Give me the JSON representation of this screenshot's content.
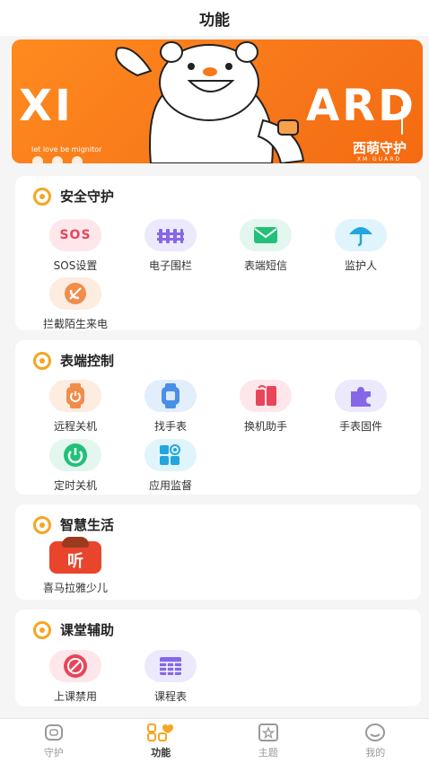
{
  "header": {
    "title": "功能"
  },
  "banner": {
    "big_left": "XI",
    "big_right": "ARD",
    "tagline": "let love be mignitor",
    "brand": "西萌守护",
    "brand_sub": "XM·GUARD"
  },
  "sections": [
    {
      "title": "安全守护",
      "items": [
        {
          "label": "SOS设置",
          "icon": "sos-icon",
          "glyph": "SOS",
          "bg": "#fde7ea",
          "color": "#e8455a"
        },
        {
          "label": "电子围栏",
          "icon": "fence-icon",
          "bg": "#ede9fc",
          "color": "#8667e8"
        },
        {
          "label": "表端短信",
          "icon": "message-icon",
          "bg": "#e3f7ee",
          "color": "#22c07a"
        },
        {
          "label": "监护人",
          "icon": "umbrella-icon",
          "bg": "#e0f4fb",
          "color": "#22a6dd"
        },
        {
          "label": "拦截陌生来电",
          "icon": "block-call-icon",
          "bg": "#fdece0",
          "color": "#f08d4a"
        }
      ]
    },
    {
      "title": "表端控制",
      "items": [
        {
          "label": "远程关机",
          "icon": "watch-power-icon",
          "bg": "#fdece0",
          "color": "#f08d4a"
        },
        {
          "label": "找手表",
          "icon": "find-watch-icon",
          "bg": "#e3eefc",
          "color": "#4a8fe6"
        },
        {
          "label": "换机助手",
          "icon": "switch-device-icon",
          "bg": "#fde7ea",
          "color": "#e8455a"
        },
        {
          "label": "手表固件",
          "icon": "puzzle-icon",
          "bg": "#ede9fc",
          "color": "#8667e8"
        },
        {
          "label": "定时关机",
          "icon": "power-icon",
          "bg": "#e3f7ee",
          "color": "#22c07a"
        },
        {
          "label": "应用监督",
          "icon": "apps-icon",
          "bg": "#e0f4fb",
          "color": "#22a6dd"
        }
      ]
    },
    {
      "title": "智慧生活",
      "items": [
        {
          "label": "喜马拉雅少儿",
          "icon": "ximalaya-kids-icon",
          "glyph": "听",
          "bg": "#e8452c",
          "color": "#ffffff"
        }
      ]
    },
    {
      "title": "课堂辅助",
      "items": [
        {
          "label": "上课禁用",
          "icon": "class-disable-icon",
          "bg": "#fde7ea",
          "color": "#e8455a"
        },
        {
          "label": "课程表",
          "icon": "timetable-icon",
          "bg": "#ede9fc",
          "color": "#8667e8"
        }
      ]
    }
  ],
  "tabbar": [
    {
      "label": "守护",
      "icon": "watch-tab-icon",
      "active": false
    },
    {
      "label": "功能",
      "icon": "grid-heart-tab-icon",
      "active": true
    },
    {
      "label": "主题",
      "icon": "theme-tab-icon",
      "active": false
    },
    {
      "label": "我的",
      "icon": "profile-tab-icon",
      "active": false
    }
  ],
  "colors": {
    "accent": "#f5a623",
    "banner": "#f7771a"
  }
}
